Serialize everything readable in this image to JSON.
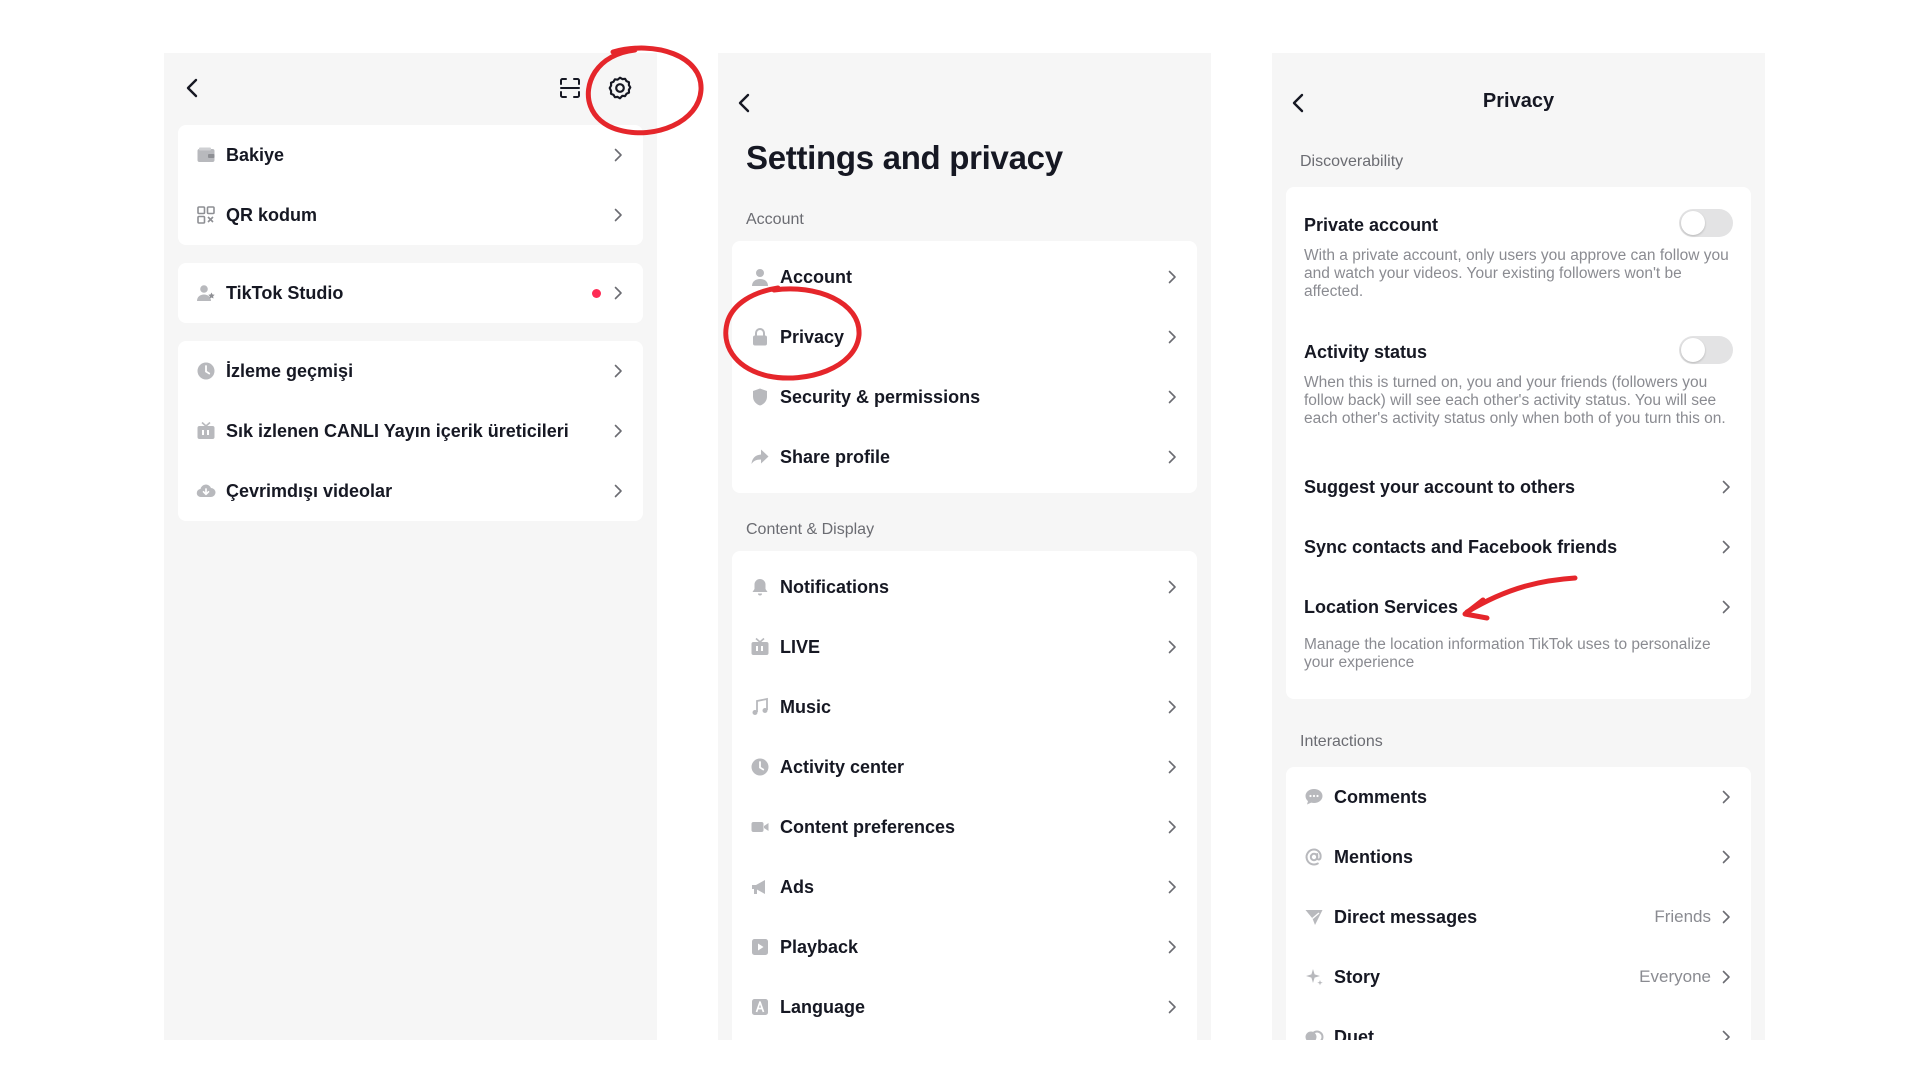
{
  "panel1": {
    "header_icons": [
      "back-icon",
      "scan-icon",
      "gear-icon"
    ],
    "group1": [
      {
        "label": "Bakiye",
        "icon": "wallet-icon"
      },
      {
        "label": "QR kodum",
        "icon": "qr-code-icon"
      }
    ],
    "group2": [
      {
        "label": "TikTok Studio",
        "icon": "person-star-icon",
        "notification_dot": true
      }
    ],
    "group3": [
      {
        "label": "İzleme geçmişi",
        "icon": "clock-icon"
      },
      {
        "label": "Sık izlenen CANLI Yayın içerik üreticileri",
        "icon": "live-tv-icon"
      },
      {
        "label": "Çevrimdışı videolar",
        "icon": "cloud-download-icon"
      }
    ]
  },
  "panel2": {
    "title": "Settings and privacy",
    "account_section": "Account",
    "account_items": [
      {
        "label": "Account",
        "icon": "person-icon"
      },
      {
        "label": "Privacy",
        "icon": "lock-icon"
      },
      {
        "label": "Security & permissions",
        "icon": "shield-icon"
      },
      {
        "label": "Share profile",
        "icon": "share-icon"
      }
    ],
    "content_section": "Content & Display",
    "content_items": [
      {
        "label": "Notifications",
        "icon": "bell-icon"
      },
      {
        "label": "LIVE",
        "icon": "live-tv-icon"
      },
      {
        "label": "Music",
        "icon": "music-note-icon"
      },
      {
        "label": "Activity center",
        "icon": "clock-icon"
      },
      {
        "label": "Content preferences",
        "icon": "video-camera-icon"
      },
      {
        "label": "Ads",
        "icon": "megaphone-icon"
      },
      {
        "label": "Playback",
        "icon": "play-icon"
      },
      {
        "label": "Language",
        "icon": "language-icon"
      }
    ]
  },
  "panel3": {
    "title": "Privacy",
    "discoverability_section": "Discoverability",
    "private_account": {
      "label": "Private account",
      "description": "With a private account, only users you approve can follow you and watch your videos. Your existing followers won't be affected.",
      "enabled": false
    },
    "activity_status": {
      "label": "Activity status",
      "description": "When this is turned on, you and your friends (followers you follow back) will see each other's activity status. You will see each other's activity status only when both of you turn this on.",
      "enabled": false
    },
    "suggest_account": "Suggest your account to others",
    "sync_contacts": "Sync contacts and Facebook friends",
    "location_services": {
      "label": "Location Services",
      "description": "Manage the location information TikTok uses to personalize your experience"
    },
    "interactions_section": "Interactions",
    "interaction_items": [
      {
        "label": "Comments",
        "icon": "comment-icon",
        "value": ""
      },
      {
        "label": "Mentions",
        "icon": "at-sign-icon",
        "value": ""
      },
      {
        "label": "Direct messages",
        "icon": "send-icon",
        "value": "Friends"
      },
      {
        "label": "Story",
        "icon": "sparkle-icon",
        "value": "Everyone"
      },
      {
        "label": "Duet",
        "icon": "duet-icon",
        "value": ""
      }
    ]
  },
  "colors": {
    "panel_bg": "#f6f6f6",
    "card_bg": "#ffffff",
    "text": "#161823",
    "muted": "#8a8b91",
    "notification_dot": "#fe2c55",
    "annotation_red": "#e5262b"
  }
}
